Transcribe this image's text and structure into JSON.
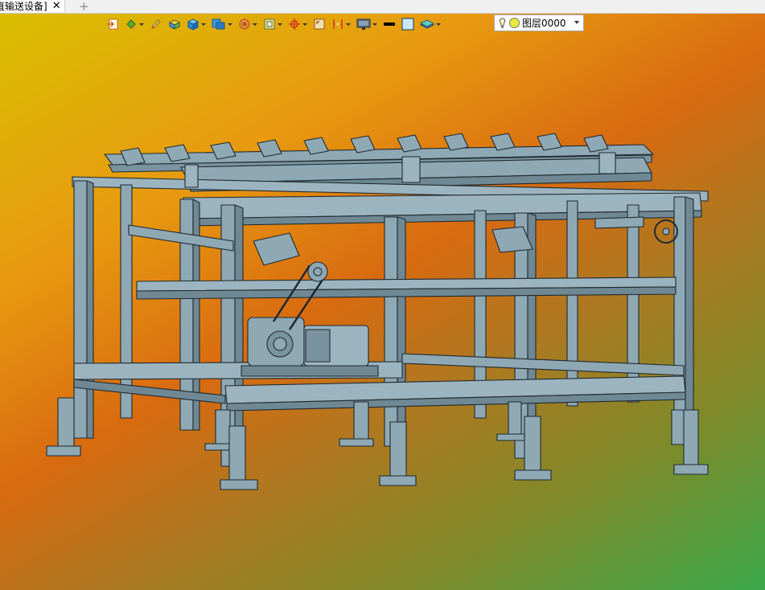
{
  "tab": {
    "title": "直输送设备]",
    "close_glyph": "✕",
    "add_glyph": "+"
  },
  "toolbar": {
    "tools": [
      {
        "icon": "exit-sketch-icon",
        "dropdown": false
      },
      {
        "icon": "paint-bucket-icon",
        "dropdown": true
      },
      {
        "icon": "pencil-icon",
        "dropdown": false
      },
      {
        "icon": "box-face-icon",
        "dropdown": false
      },
      {
        "icon": "cube-icon",
        "dropdown": true
      },
      {
        "icon": "solid-cube-icon",
        "dropdown": true
      },
      {
        "icon": "render-wheel-icon",
        "dropdown": true
      },
      {
        "icon": "frame-view-icon",
        "dropdown": true
      },
      {
        "icon": "target-axis-icon",
        "dropdown": true
      },
      {
        "icon": "fit-view-icon",
        "dropdown": false
      },
      {
        "icon": "section-view-icon",
        "dropdown": true
      },
      {
        "icon": "monitor-icon",
        "dropdown": true
      },
      {
        "icon": "line-width-icon",
        "dropdown": false
      },
      {
        "icon": "color-swatch-icon",
        "dropdown": false
      },
      {
        "icon": "layers-icon",
        "dropdown": true
      }
    ],
    "layer": {
      "label": "图层0000",
      "color": "#e8e840"
    }
  },
  "viewport": {
    "model": "conveyor-frame-assembly",
    "model_color": "#8ea8b4",
    "background": [
      "#d8c000",
      "#e89a10",
      "#d86a10",
      "#3aa84a"
    ]
  }
}
